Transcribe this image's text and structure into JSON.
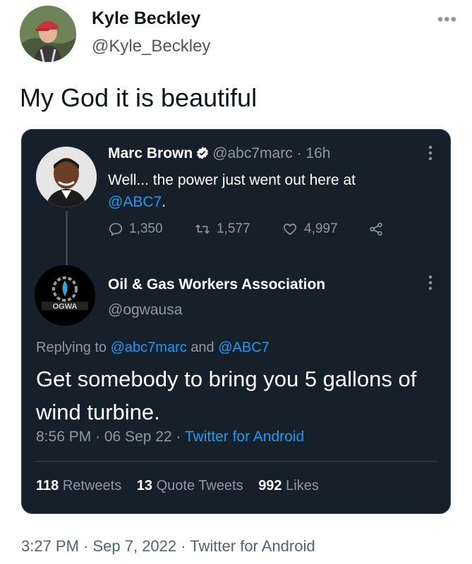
{
  "outer_tweet": {
    "name": "Kyle Beckley",
    "handle": "@Kyle_Beckley",
    "more": "•••",
    "text": "My God it is beautiful",
    "timestamp": "3:27 PM · Sep 7, 2022 · Twitter for Android"
  },
  "quoted_card": {
    "parent": {
      "name": "Marc Brown",
      "handle": "@abc7marc",
      "dot": "·",
      "age": "16h",
      "text": "Well... the power just went out here at",
      "mention": "@ABC7",
      "mention_suffix": ".",
      "replies": "1,350",
      "retweets": "1,577",
      "likes": "4,997"
    },
    "reply": {
      "name": "Oil & Gas Workers Association",
      "handle": "@ogwausa",
      "replying_prefix": "Replying to",
      "replying_user1": "@abc7marc",
      "replying_and": "and",
      "replying_user2": "@ABC7",
      "text": "Get somebody to bring you 5 gallons of wind turbine.",
      "time": "8:56 PM · 06 Sep 22 ·",
      "app": "Twitter for Android",
      "avatar_text": "OGWA"
    },
    "stats": {
      "retweets_num": "118",
      "retweets_label": "Retweets",
      "quotes_num": "13",
      "quotes_label": "Quote Tweets",
      "likes_num": "992",
      "likes_label": "Likes"
    },
    "more_icon": "vertical-ellipsis"
  },
  "colors": {
    "card_bg": "#15202b",
    "link": "#1d9bf0",
    "muted": "#8b98a5"
  }
}
